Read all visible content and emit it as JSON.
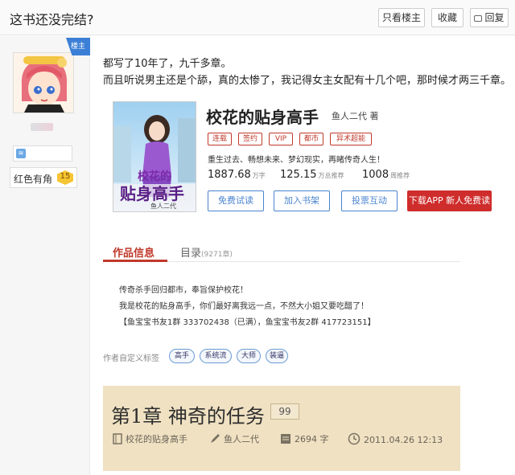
{
  "thread": {
    "title": "这书还没完结?",
    "only_owner_label": "只看楼主",
    "fav_label": "收藏",
    "reply_label": "回复"
  },
  "author_panel": {
    "owner_tag": "楼主",
    "red_label": "红色有角",
    "level": "15"
  },
  "post": {
    "line1": "都写了10年了，九千多章。",
    "line2": "而且听说男主还是个舔，真的太惨了，我记得女主女配有十几个吧，那时候才两三千章。"
  },
  "book": {
    "title": "校花的贴身高手",
    "author": "鱼人二代 著",
    "tags": [
      "连载",
      "签约",
      "VIP",
      "都市",
      "异术超能"
    ],
    "intro": "重生过去、畅想未来、梦幻现实，再睹传奇人生！",
    "word_count": "1887.68",
    "word_unit": "万字",
    "recommend": "125.15",
    "recommend_unit": "万总推荐",
    "weekly": "1008",
    "weekly_unit": "周推荐",
    "buttons": {
      "free_read": "免费试读",
      "add_shelf": "加入书架",
      "vote": "投票互动",
      "app": "下载APP 新人免费读"
    },
    "cover_text_1": "校花的",
    "cover_text_2": "贴身高手",
    "cover_author": "鱼人二代"
  },
  "tabs": {
    "info": "作品信息",
    "toc": "目录",
    "toc_count": "(9271章)"
  },
  "description": {
    "line1": "传奇杀手回归都市，奉旨保护校花！",
    "line2": "我是校花的贴身高手，你们最好离我远一点，不然大小姐又要吃醋了！",
    "line3": "【鱼宝宝书友1群 333702438（已满），鱼宝宝书友2群 417723151】"
  },
  "custom_tags": {
    "label": "作者自定义标签",
    "items": [
      "高手",
      "系统流",
      "大师",
      "装逼"
    ]
  },
  "chapter": {
    "title": "第1章 神奇的任务",
    "comments": "99",
    "book": "校花的贴身高手",
    "author": "鱼人二代",
    "words": "2694 字",
    "date": "2011.04.26 12:13"
  }
}
